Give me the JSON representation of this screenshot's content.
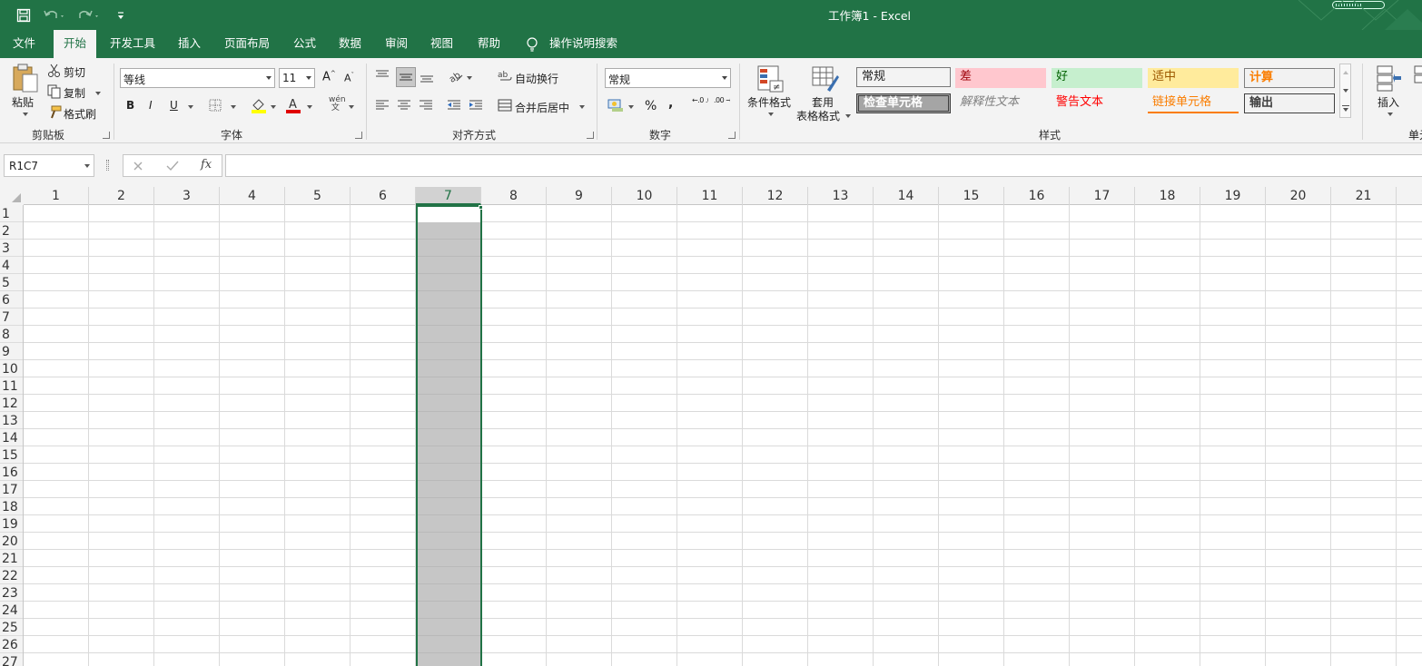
{
  "window": {
    "title": "工作簿1  -  Excel"
  },
  "menu": {
    "tabs": [
      "文件",
      "开始",
      "开发工具",
      "插入",
      "页面布局",
      "公式",
      "数据",
      "审阅",
      "视图",
      "帮助"
    ],
    "active_tab": "开始",
    "search": "操作说明搜索"
  },
  "ribbon": {
    "clipboard": {
      "paste": "粘贴",
      "cut": "剪切",
      "copy": "复制",
      "format_painter": "格式刷",
      "label": "剪贴板"
    },
    "font": {
      "name": "等线",
      "size": "11",
      "label": "字体",
      "bold": "B",
      "italic": "I",
      "underline": "U",
      "phonetic": "wén"
    },
    "alignment": {
      "wrap": "自动换行",
      "merge": "合并后居中",
      "label": "对齐方式"
    },
    "number": {
      "format": "常规",
      "label": "数字",
      "percent": "%",
      "comma": ",",
      "inc_decimal": "←.0 .00",
      "dec_decimal": ".00 →.0"
    },
    "styles": {
      "conditional": "条件格式",
      "table_line1": "套用",
      "table_line2": "表格格式",
      "label": "样式",
      "cells": [
        {
          "text": "常规",
          "bg": "#ffffff",
          "color": "#000000"
        },
        {
          "text": "差",
          "bg": "#ffc7ce",
          "color": "#9c0006"
        },
        {
          "text": "好",
          "bg": "#c6efce",
          "color": "#006100"
        },
        {
          "text": "适中",
          "bg": "#ffeb9c",
          "color": "#9c5700"
        },
        {
          "text": "计算",
          "bg": "#f2f2f2",
          "color": "#fa7d00"
        },
        {
          "text": "检查单元格",
          "bg": "#a5a5a5",
          "color": "#ffffff"
        },
        {
          "text": "解释性文本",
          "bg": "#f3f3f3",
          "color": "#7f7f7f"
        },
        {
          "text": "警告文本",
          "bg": "#f3f3f3",
          "color": "#ff0000"
        },
        {
          "text": "链接单元格",
          "bg": "#f3f3f3",
          "color": "#fa7d00"
        },
        {
          "text": "输出",
          "bg": "#f2f2f2",
          "color": "#3f3f3f"
        }
      ]
    },
    "cells_group": {
      "insert": "插入",
      "label": "单元"
    }
  },
  "formula_bar": {
    "name_box": "R1C7",
    "fx": "fx",
    "formula": ""
  },
  "grid": {
    "columns": [
      "1",
      "2",
      "3",
      "4",
      "5",
      "6",
      "7",
      "8",
      "9",
      "10",
      "11",
      "12",
      "13",
      "14",
      "15",
      "16",
      "17",
      "18",
      "19",
      "20",
      "21"
    ],
    "rows": [
      "1",
      "2",
      "3",
      "4",
      "5",
      "6",
      "7",
      "8",
      "9",
      "10",
      "11",
      "12",
      "13",
      "14",
      "15",
      "16",
      "17",
      "18",
      "19",
      "20",
      "21",
      "22",
      "23",
      "24",
      "25",
      "26",
      "27"
    ],
    "selected_column": "7",
    "accent": "#217346"
  }
}
